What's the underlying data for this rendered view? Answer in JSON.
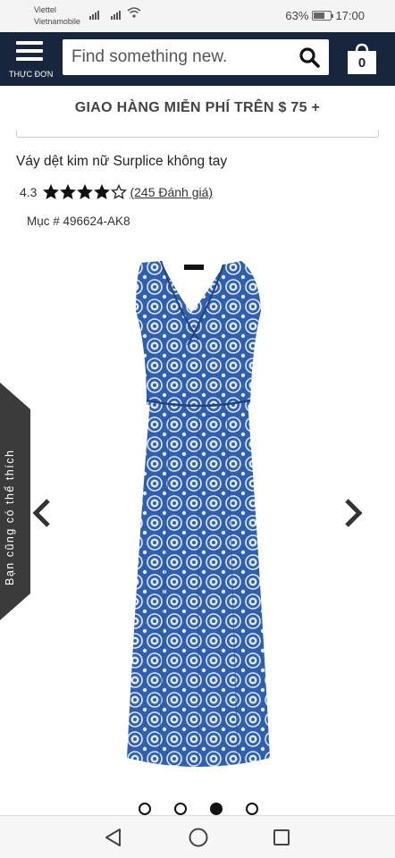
{
  "status_bar": {
    "carrier1": "Viettel",
    "carrier2": "Vietnamobile",
    "battery_percent": "63%",
    "battery_level": 0.63,
    "time": "17:00"
  },
  "header": {
    "menu_label": "THỰC ĐƠN",
    "search_placeholder": "Find something new.",
    "cart_count": "0",
    "colors": {
      "header_bg": "#17263c"
    }
  },
  "promo": {
    "text": "GIAO HÀNG MIỄN PHÍ TRÊN $ 75 +"
  },
  "product": {
    "title": "Váy dệt kim nữ Surplice không tay",
    "rating": "4.3",
    "rating_value": 4.3,
    "stars_filled": 4,
    "stars_total": 5,
    "reviews": "(245 Đánh giá)",
    "sku": "Mục # 496624-AK8",
    "image_alt": "blue medallion print sleeveless maxi dress",
    "colors": {
      "dress_base": "#2f5fae",
      "dress_print": "#dfe9f7"
    }
  },
  "carousel": {
    "total": 4,
    "active_index": 2,
    "side_tab_label": "Bạn cũng có thể thích"
  },
  "navbar": {
    "icons": [
      "back-icon",
      "home-icon",
      "recent-apps-icon"
    ]
  }
}
